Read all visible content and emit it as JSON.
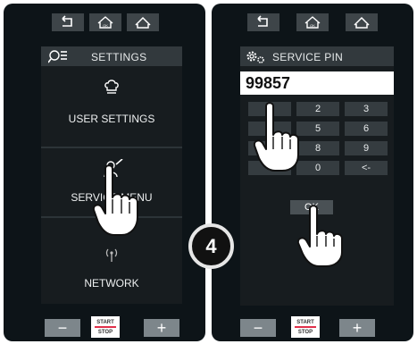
{
  "left": {
    "header": {
      "title": "SETTINGS",
      "icon": "search-list-icon"
    },
    "menu": [
      {
        "label": "USER SETTINGS",
        "icon": "chef-hat-icon"
      },
      {
        "label": "SERVICE MENU",
        "icon": "technician-icon"
      },
      {
        "label": "NETWORK",
        "icon": "antenna-icon"
      }
    ]
  },
  "right": {
    "header": {
      "title": "SERVICE PIN",
      "icon": "gears-icon"
    },
    "pin_value": "99857",
    "keypad": [
      "1",
      "2",
      "3",
      "4",
      "5",
      "6",
      "7",
      "8",
      "9",
      ".",
      "0",
      "<-"
    ],
    "ok_label": "OK"
  },
  "top_buttons": [
    "back-icon",
    "home-settings-icon",
    "home-icon"
  ],
  "bottom": {
    "minus_label": "−",
    "plus_label": "+",
    "start_label": "START",
    "stop_label": "STOP"
  },
  "step_number": "4",
  "colors": {
    "panel": "#0d1418",
    "button": "#7d868b",
    "accent": "#e0304a"
  }
}
